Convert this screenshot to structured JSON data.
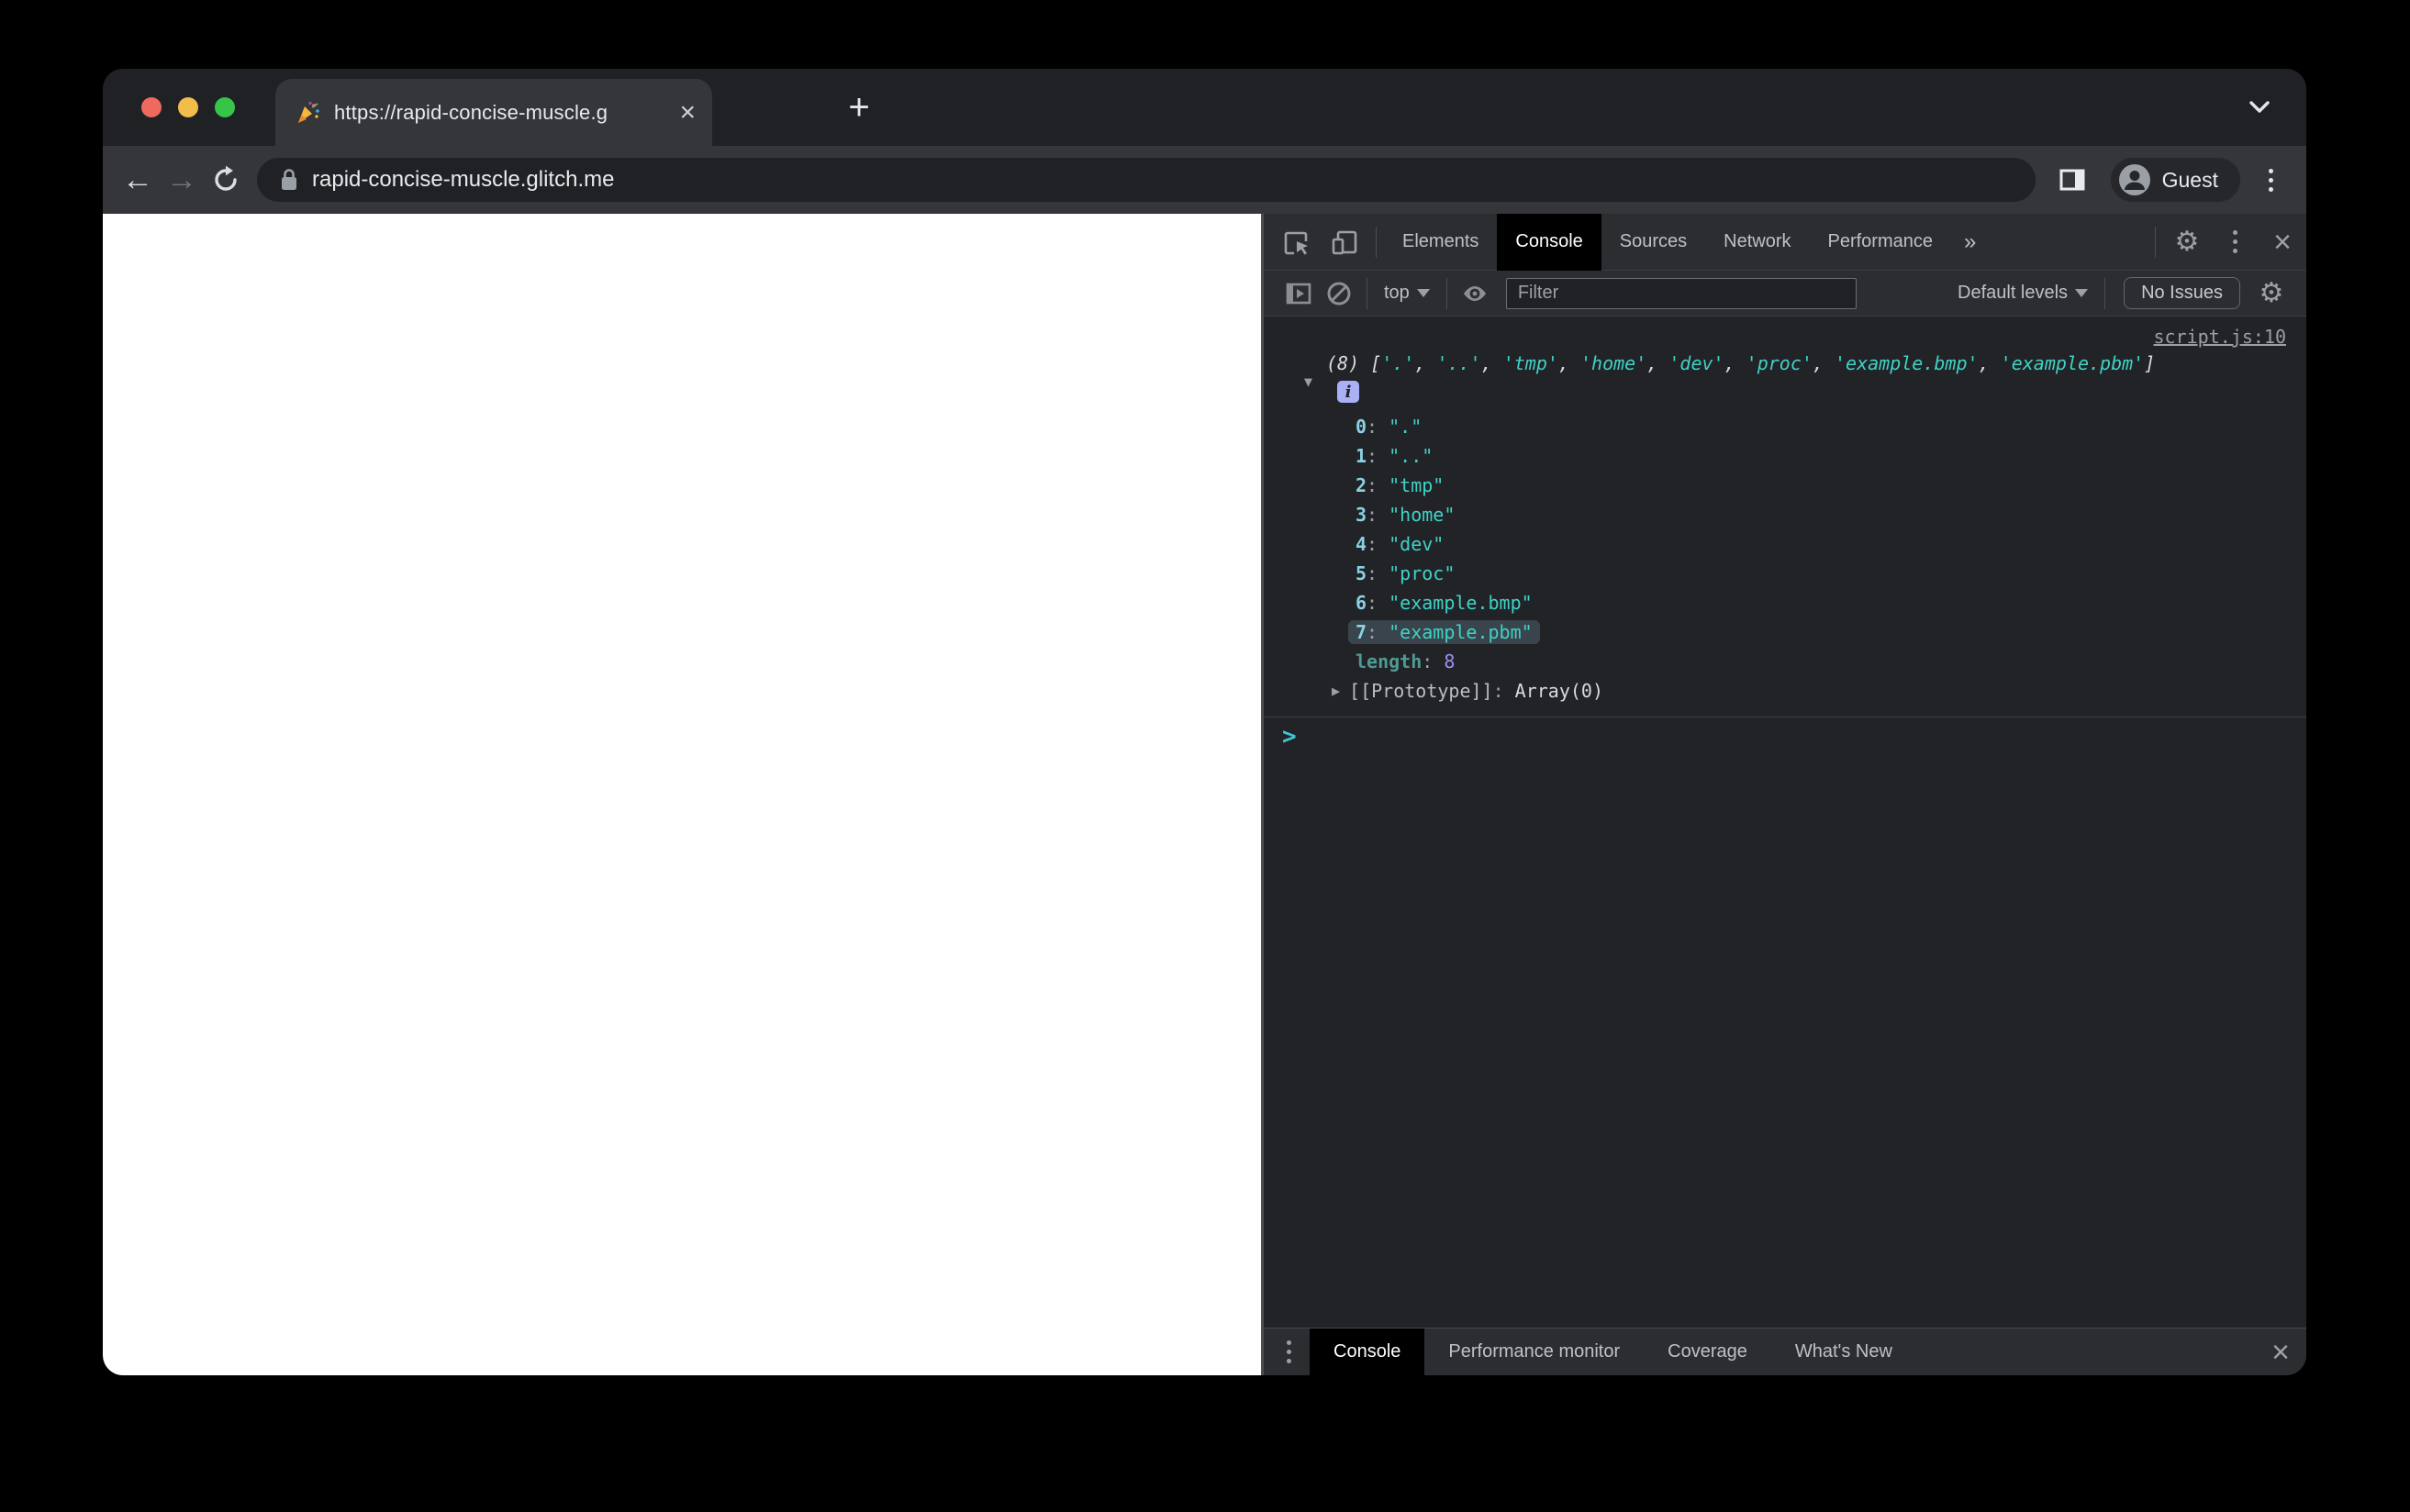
{
  "browser": {
    "tab_title": "https://rapid-concise-muscle.g",
    "url": "rapid-concise-muscle.glitch.me",
    "profile_label": "Guest",
    "new_tab_glyph": "+",
    "tab_close_glyph": "×"
  },
  "devtools": {
    "panel_tabs": [
      {
        "label": "Elements",
        "selected": false
      },
      {
        "label": "Console",
        "selected": true
      },
      {
        "label": "Sources",
        "selected": false
      },
      {
        "label": "Network",
        "selected": false
      },
      {
        "label": "Performance",
        "selected": false
      }
    ],
    "more_tabs_glyph": "»",
    "close_glyph": "×",
    "toolbar": {
      "context_selector": "top",
      "filter_placeholder": "Filter",
      "levels_label": "Default levels",
      "issues_label": "No Issues"
    },
    "console": {
      "source_link": "script.js:10",
      "count_badge": "(8)",
      "open_bracket": "[",
      "close_bracket": "]",
      "values": [
        ".",
        "..",
        "tmp",
        "home",
        "dev",
        "proc",
        "example.bmp",
        "example.pbm"
      ],
      "highlighted_index": 7,
      "length_label": "length",
      "length_value": "8",
      "prototype_label": "[[Prototype]]",
      "prototype_separator": ": ",
      "prototype_value": "Array(0)",
      "prompt_glyph": ">",
      "expand_caret": "▼",
      "collapsed_caret": "▶"
    },
    "drawer_tabs": [
      {
        "label": "Console",
        "selected": true
      },
      {
        "label": "Performance monitor",
        "selected": false
      },
      {
        "label": "Coverage",
        "selected": false
      },
      {
        "label": "What's New",
        "selected": false
      }
    ]
  },
  "colors": {
    "string-teal": "#3fd3c6",
    "index-blue": "#8ad2e4",
    "number-violet": "#9e8ef2",
    "dim-teal": "#4f9a92",
    "highlight-bg": "#3a444c",
    "info-badge-bg": "#a9b0f5",
    "prompt-teal": "#3fc6d4",
    "selected-tab-bg": "#000000",
    "traffic-red": "#ee6a5f",
    "traffic-yellow": "#f2bd4c",
    "traffic-green": "#35c648"
  }
}
